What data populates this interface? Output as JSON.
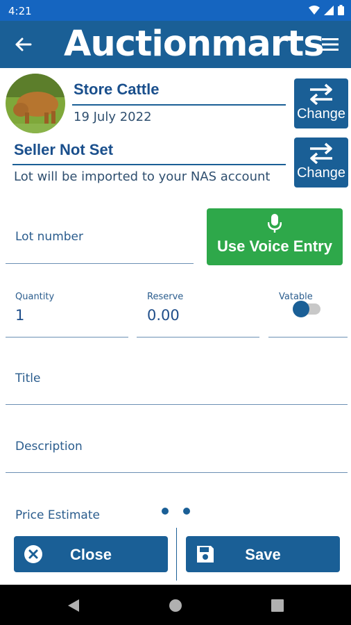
{
  "status_bar": {
    "time": "4:21"
  },
  "header": {
    "app_title": "Auctionmarts"
  },
  "sale": {
    "title": "Store Cattle",
    "date": "19 July 2022",
    "change_label": "Change"
  },
  "seller": {
    "title": "Seller Not Set",
    "note": "Lot will be imported to your NAS account",
    "change_label": "Change"
  },
  "lot": {
    "label": "Lot number",
    "value": ""
  },
  "voice": {
    "label": "Use Voice Entry"
  },
  "quantity": {
    "label": "Quantity",
    "value": "1"
  },
  "reserve": {
    "label": "Reserve",
    "value": "0.00"
  },
  "vatable": {
    "label": "Vatable",
    "on": false
  },
  "title_field": {
    "label": "Title",
    "value": ""
  },
  "description_field": {
    "label": "Description",
    "value": ""
  },
  "price_field": {
    "label": "Price Estimate"
  },
  "actions": {
    "close_label": "Close",
    "save_label": "Save"
  },
  "colors": {
    "primary": "#1a5f96",
    "accent_green": "#2ea84a",
    "status_bar": "#1565c0"
  },
  "icons": [
    "back-arrow-icon",
    "menu-icon",
    "swap-icon",
    "microphone-icon",
    "close-circle-icon",
    "floppy-disk-icon",
    "wifi-icon",
    "signal-icon",
    "battery-icon",
    "nav-back-icon",
    "nav-home-icon",
    "nav-recents-icon"
  ]
}
